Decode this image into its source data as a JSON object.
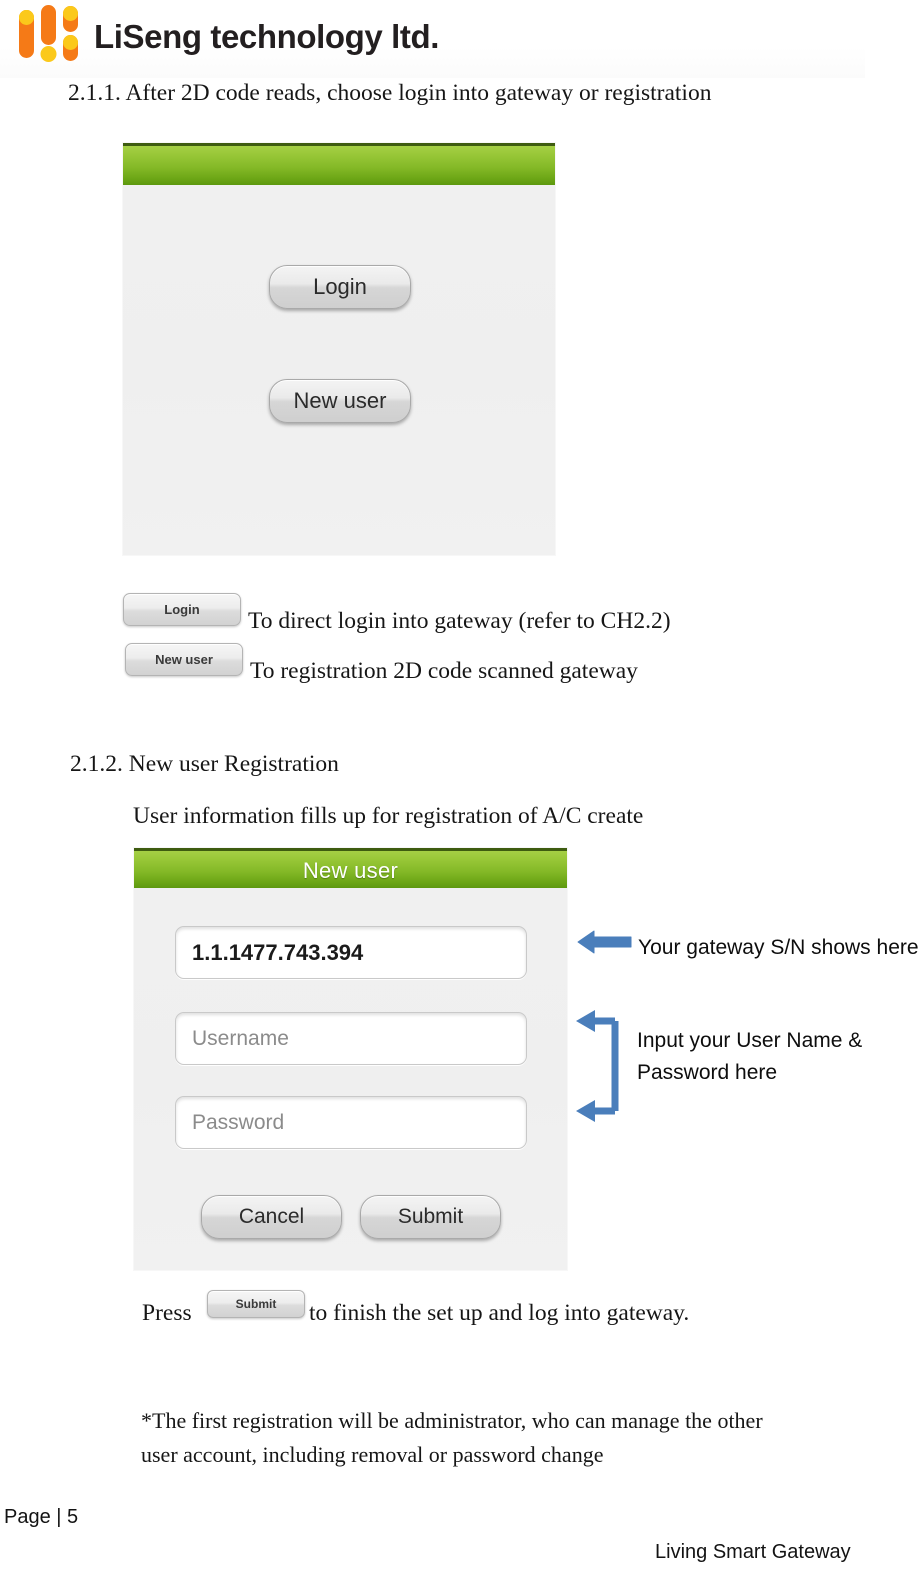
{
  "brand": {
    "logo_icon": "liseng-logo-icon",
    "name": "LiSeng technology ltd.",
    "orange": "#F57A17",
    "yellow": "#FBC91B"
  },
  "sections": [
    {
      "id": "2.1.1",
      "heading": "2.1.1. After 2D code reads, choose login into gateway or registration"
    },
    {
      "id": "2.1.2",
      "heading": "2.1.2. New user Registration",
      "subtext": "User information fills up for registration of A/C create"
    }
  ],
  "screenshot_login": {
    "titlebar": "",
    "accent_green": "#84B927",
    "buttons": [
      {
        "label": "Login"
      },
      {
        "label": "New user"
      }
    ]
  },
  "legend": [
    {
      "button_label": "Login",
      "description": "To direct login into gateway (refer to CH2.2)"
    },
    {
      "button_label": "New user",
      "description": "To registration 2D code scanned gateway"
    }
  ],
  "screenshot_newuser": {
    "titlebar": "New user",
    "accent_green": "#84B927",
    "serial_value": "1.1.1477.743.394",
    "username_placeholder": "Username",
    "password_placeholder": "Password",
    "cancel_label": "Cancel",
    "submit_label": "Submit"
  },
  "annotations": {
    "arrow_color": "#4A7EBB",
    "serial_note": "Your gateway S/N shows here",
    "credentials_note_line1": "Input your User Name &",
    "credentials_note_line2": "Password here"
  },
  "press_line": {
    "prefix": "Press",
    "button_label": "Submit",
    "suffix": "to finish the set up and log into gateway."
  },
  "footnote": {
    "line1": "*The first registration will be administrator, who can manage the other",
    "line2": "user account, including removal or password change"
  },
  "footer": {
    "page": "Page | 5",
    "product": "Living Smart Gateway"
  }
}
